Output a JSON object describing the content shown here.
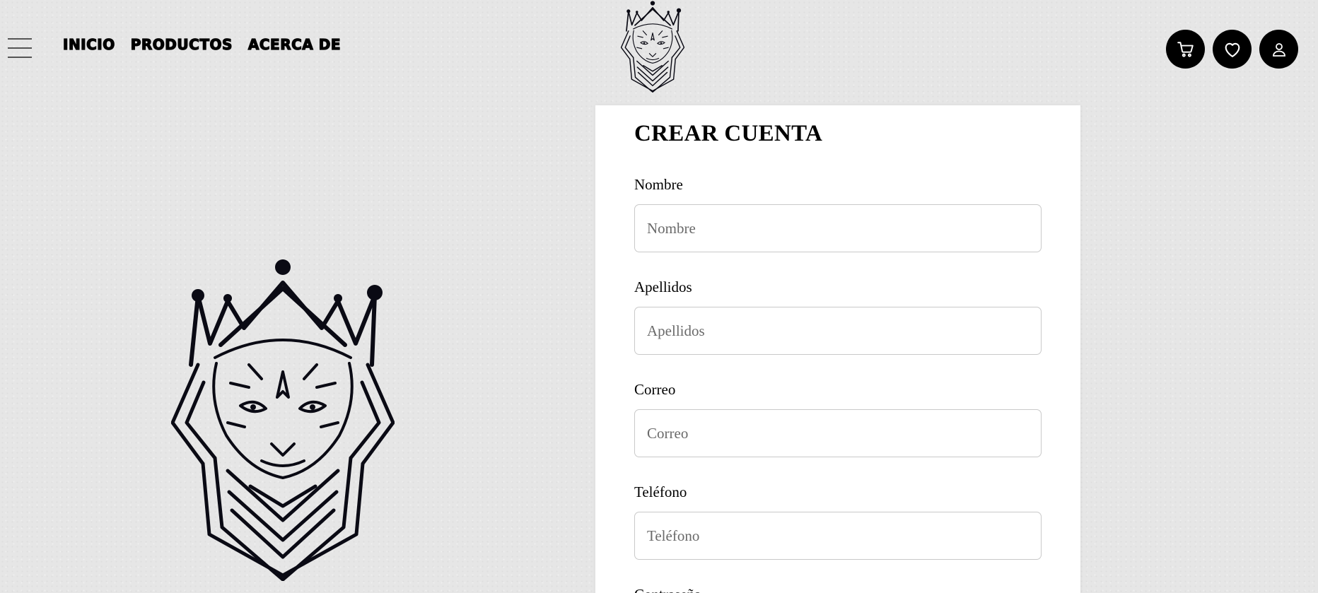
{
  "nav": {
    "items": [
      {
        "label": "INICIO"
      },
      {
        "label": "PRODUCTOS"
      },
      {
        "label": "ACERCA DE"
      }
    ]
  },
  "header": {
    "icons": {
      "menu": "hamburger-menu-icon",
      "cart": "cart-icon",
      "wishlist": "heart-icon",
      "account": "user-icon"
    },
    "icon_bg": "#000000"
  },
  "form": {
    "title": "CREAR CUENTA",
    "fields": [
      {
        "label": "Nombre",
        "placeholder": "Nombre"
      },
      {
        "label": "Apellidos",
        "placeholder": "Apellidos"
      },
      {
        "label": "Correo",
        "placeholder": "Correo"
      },
      {
        "label": "Teléfono",
        "placeholder": "Teléfono"
      },
      {
        "label": "Contraseña"
      }
    ]
  },
  "colors": {
    "background": "#e6e6e6",
    "card": "#ffffff",
    "text": "#000000",
    "input_border": "#c9c9c9"
  }
}
